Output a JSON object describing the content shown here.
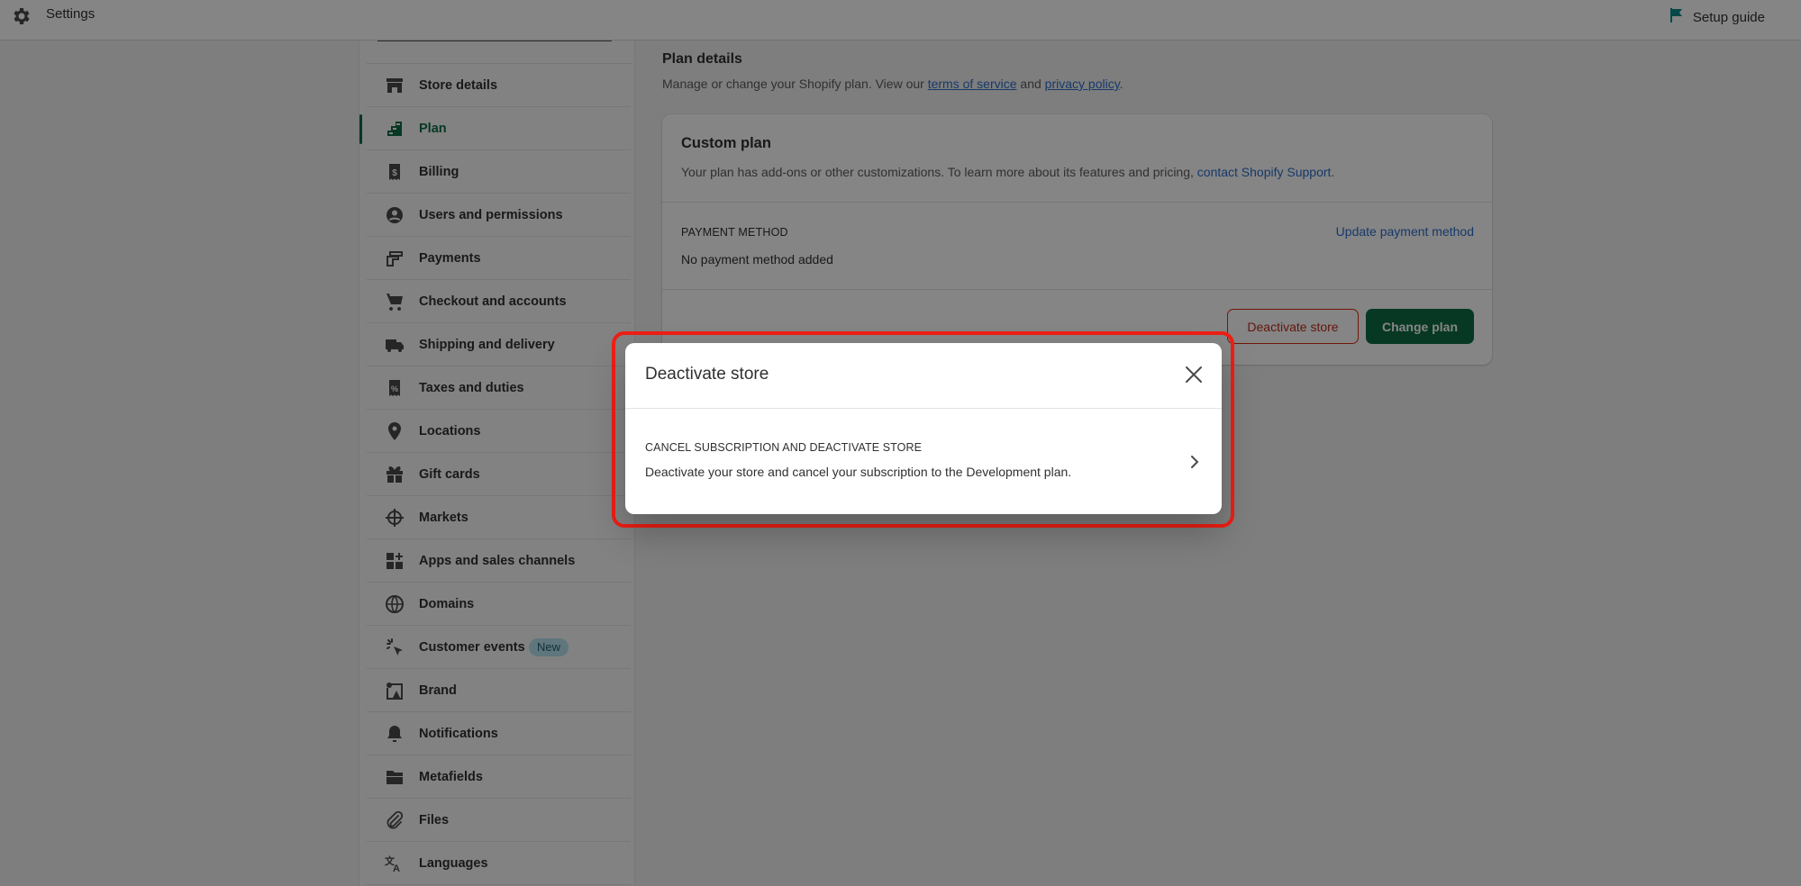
{
  "topbar": {
    "title": "Settings",
    "setup_guide": "Setup guide",
    "icons": {
      "settings": "gear-icon",
      "setup": "flag-icon"
    }
  },
  "sidebar": {
    "active_index": 1,
    "items": [
      {
        "label": "Store details",
        "icon": "store-icon"
      },
      {
        "label": "Plan",
        "icon": "plan-icon"
      },
      {
        "label": "Billing",
        "icon": "billing-icon"
      },
      {
        "label": "Users and permissions",
        "icon": "user-icon"
      },
      {
        "label": "Payments",
        "icon": "payments-icon"
      },
      {
        "label": "Checkout and accounts",
        "icon": "cart-icon"
      },
      {
        "label": "Shipping and delivery",
        "icon": "truck-icon"
      },
      {
        "label": "Taxes and duties",
        "icon": "tax-icon"
      },
      {
        "label": "Locations",
        "icon": "location-icon"
      },
      {
        "label": "Gift cards",
        "icon": "gift-icon"
      },
      {
        "label": "Markets",
        "icon": "markets-icon"
      },
      {
        "label": "Apps and sales channels",
        "icon": "apps-icon"
      },
      {
        "label": "Domains",
        "icon": "globe-icon"
      },
      {
        "label": "Customer events",
        "icon": "cursor-click-icon",
        "badge": "New"
      },
      {
        "label": "Brand",
        "icon": "brand-icon"
      },
      {
        "label": "Notifications",
        "icon": "bell-icon"
      },
      {
        "label": "Metafields",
        "icon": "metafields-icon"
      },
      {
        "label": "Files",
        "icon": "paperclip-icon"
      },
      {
        "label": "Languages",
        "icon": "translate-icon"
      }
    ]
  },
  "main": {
    "title": "Plan details",
    "subtitle_prefix": "Manage or change your Shopify plan. View our ",
    "terms_link": "terms of service",
    "subtitle_mid": " and ",
    "privacy_link": "privacy policy",
    "subtitle_suffix": ".",
    "card": {
      "plan_name": "Custom plan",
      "plan_desc_prefix": "Your plan has add-ons or other customizations. To learn more about its features and pricing, ",
      "support_link": "contact Shopify Support",
      "plan_desc_suffix": ".",
      "payment_label": "PAYMENT METHOD",
      "payment_value": "No payment method added",
      "update_payment_link": "Update payment method",
      "deactivate_button": "Deactivate store",
      "change_plan_button": "Change plan"
    }
  },
  "modal": {
    "title": "Deactivate store",
    "option_title": "CANCEL SUBSCRIPTION AND DEACTIVATE STORE",
    "option_desc": "Deactivate your store and cancel your subscription to the Development plan."
  },
  "colors": {
    "brand_green": "#0f6b45",
    "link_blue": "#2c6ecb",
    "critical_red": "#d82c0d",
    "highlight_red": "#f01e14",
    "badge_bg": "#b4e3ee"
  }
}
